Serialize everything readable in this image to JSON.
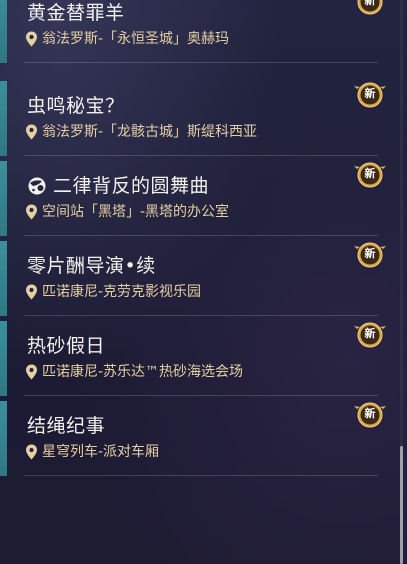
{
  "quests": [
    {
      "title": "黄金替罪羊",
      "location": "翁法罗斯-「永恒圣城」奥赫玛",
      "badge": "新",
      "has_title_icon": false
    },
    {
      "title": "虫鸣秘宝？",
      "location": "翁法罗斯-「龙骸古城」斯缇科西亚",
      "badge": "新",
      "has_title_icon": false
    },
    {
      "title": "二律背反的圆舞曲",
      "location": "空间站「黑塔」-黑塔的办公室",
      "badge": "新",
      "has_title_icon": true,
      "title_icon": "herta-doll-icon"
    },
    {
      "title": "零片酬导演•续",
      "location": "匹诺康尼-克劳克影视乐园",
      "badge": "新",
      "has_title_icon": false
    },
    {
      "title": "热砂假日",
      "location": "匹诺康尼-苏乐达™热砂海选会场",
      "badge": "新",
      "has_title_icon": false
    },
    {
      "title": "结绳纪事",
      "location": "星穹列车-派对车厢",
      "badge": "新",
      "has_title_icon": false
    }
  ],
  "colors": {
    "accent_bar": "#3b8f9c",
    "title_text": "#f3f1ee",
    "location_text": "#e6cfa3",
    "badge_gold": "#d9a441"
  },
  "icons": {
    "location": "map-pin-icon",
    "badge": "new-badge-icon"
  }
}
